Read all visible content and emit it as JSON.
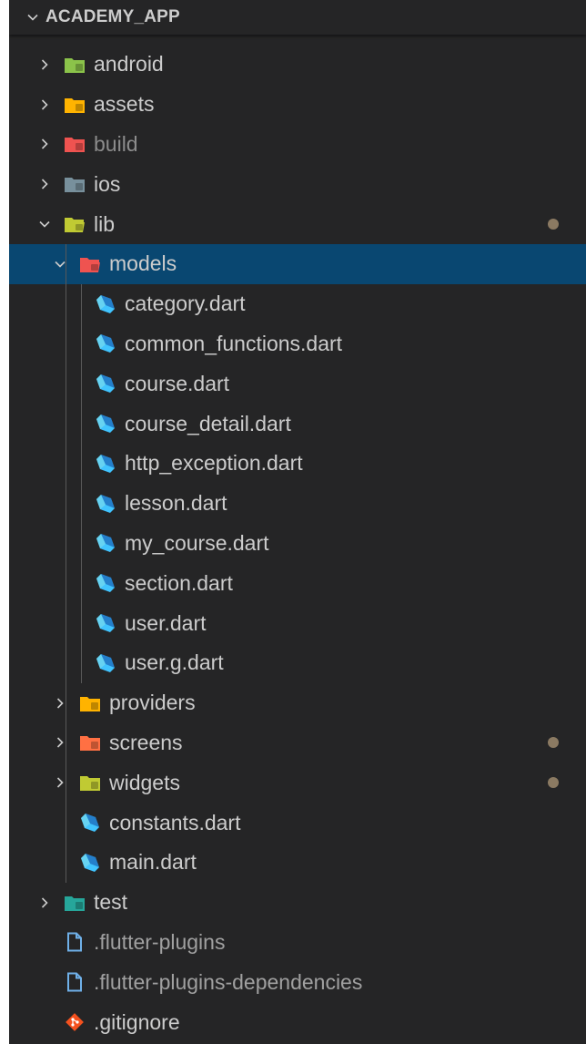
{
  "explorer": {
    "section_title": "ACADEMY_APP",
    "items": [
      {
        "label": "android",
        "type": "folder",
        "depth": 0,
        "expanded": false,
        "icon": "android-folder-icon",
        "color": "#8bc34a"
      },
      {
        "label": "assets",
        "type": "folder",
        "depth": 0,
        "expanded": false,
        "icon": "assets-folder-icon",
        "color": "#ffb300"
      },
      {
        "label": "build",
        "type": "folder",
        "depth": 0,
        "expanded": false,
        "icon": "build-folder-icon",
        "color": "#ef5350",
        "dimmed": true
      },
      {
        "label": "ios",
        "type": "folder",
        "depth": 0,
        "expanded": false,
        "icon": "ios-folder-icon",
        "color": "#78909c"
      },
      {
        "label": "lib",
        "type": "folder",
        "depth": 0,
        "expanded": true,
        "icon": "lib-folder-icon",
        "color": "#c0ca33",
        "modified": true
      },
      {
        "label": "models",
        "type": "folder",
        "depth": 1,
        "expanded": true,
        "icon": "models-folder-icon",
        "color": "#ef5350",
        "selected": true
      },
      {
        "label": "category.dart",
        "type": "dart",
        "depth": 2,
        "icon": "dart-file-icon"
      },
      {
        "label": "common_functions.dart",
        "type": "dart",
        "depth": 2,
        "icon": "dart-file-icon"
      },
      {
        "label": "course.dart",
        "type": "dart",
        "depth": 2,
        "icon": "dart-file-icon"
      },
      {
        "label": "course_detail.dart",
        "type": "dart",
        "depth": 2,
        "icon": "dart-file-icon"
      },
      {
        "label": "http_exception.dart",
        "type": "dart",
        "depth": 2,
        "icon": "dart-file-icon"
      },
      {
        "label": "lesson.dart",
        "type": "dart",
        "depth": 2,
        "icon": "dart-file-icon"
      },
      {
        "label": "my_course.dart",
        "type": "dart",
        "depth": 2,
        "icon": "dart-file-icon"
      },
      {
        "label": "section.dart",
        "type": "dart",
        "depth": 2,
        "icon": "dart-file-icon"
      },
      {
        "label": "user.dart",
        "type": "dart",
        "depth": 2,
        "icon": "dart-file-icon"
      },
      {
        "label": "user.g.dart",
        "type": "dart",
        "depth": 2,
        "icon": "dart-file-icon"
      },
      {
        "label": "providers",
        "type": "folder",
        "depth": 1,
        "expanded": false,
        "icon": "providers-folder-icon",
        "color": "#ffb300"
      },
      {
        "label": "screens",
        "type": "folder",
        "depth": 1,
        "expanded": false,
        "icon": "screens-folder-icon",
        "color": "#ff7043",
        "modified": true
      },
      {
        "label": "widgets",
        "type": "folder",
        "depth": 1,
        "expanded": false,
        "icon": "widgets-folder-icon",
        "color": "#c0ca33",
        "modified": true
      },
      {
        "label": "constants.dart",
        "type": "dart",
        "depth": 1,
        "icon": "dart-file-icon"
      },
      {
        "label": "main.dart",
        "type": "dart",
        "depth": 1,
        "icon": "dart-file-icon"
      },
      {
        "label": "test",
        "type": "folder",
        "depth": 0,
        "expanded": false,
        "icon": "test-folder-icon",
        "color": "#26a69a"
      },
      {
        "label": ".flutter-plugins",
        "type": "plain",
        "depth": 0,
        "icon": "generic-file-icon",
        "muted": true
      },
      {
        "label": ".flutter-plugins-dependencies",
        "type": "plain",
        "depth": 0,
        "icon": "generic-file-icon",
        "muted": true
      },
      {
        "label": ".gitignore",
        "type": "git",
        "depth": 0,
        "icon": "git-file-icon"
      }
    ]
  },
  "colors": {
    "sidebar_bg": "#252526",
    "selection_bg": "#094771",
    "text": "#cccccc",
    "modified_dot": "#8b7a62",
    "dart_blue": "#40c4ff",
    "git_orange": "#f4511e"
  }
}
